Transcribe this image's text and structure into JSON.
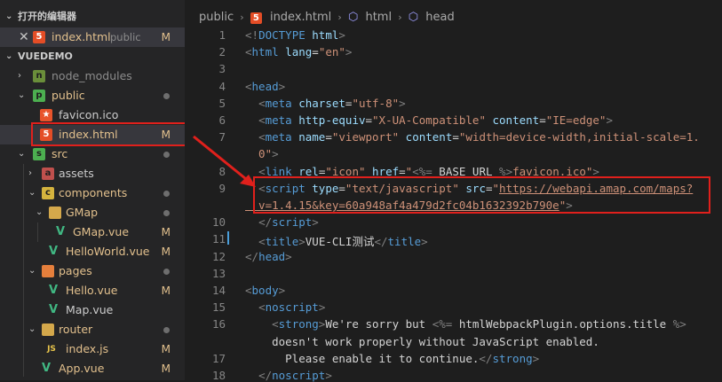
{
  "explorer": {
    "open_editors_title": "打开的编辑器",
    "open_editor_item": {
      "name": "index.html",
      "folder": "public",
      "status": "M"
    },
    "project_title": "VUEDEMO",
    "tree": [
      {
        "name": "node_modules",
        "type": "folder"
      },
      {
        "name": "public",
        "type": "folder"
      },
      {
        "name": "favicon.ico",
        "type": "file"
      },
      {
        "name": "index.html",
        "type": "file",
        "status": "M"
      },
      {
        "name": "src",
        "type": "folder"
      },
      {
        "name": "assets",
        "type": "folder"
      },
      {
        "name": "components",
        "type": "folder"
      },
      {
        "name": "GMap",
        "type": "folder"
      },
      {
        "name": "GMap.vue",
        "type": "file",
        "status": "M"
      },
      {
        "name": "HelloWorld.vue",
        "type": "file",
        "status": "M"
      },
      {
        "name": "pages",
        "type": "folder"
      },
      {
        "name": "Hello.vue",
        "type": "file",
        "status": "M"
      },
      {
        "name": "Map.vue",
        "type": "file"
      },
      {
        "name": "router",
        "type": "folder"
      },
      {
        "name": "index.js",
        "type": "file",
        "status": "M"
      },
      {
        "name": "App.vue",
        "type": "file",
        "status": "M"
      }
    ]
  },
  "breadcrumb": {
    "folder": "public",
    "file": "index.html",
    "node1": "html",
    "node2": "head"
  },
  "code": {
    "line_numbers": [
      "1",
      "2",
      "3",
      "4",
      "5",
      "6",
      "7",
      "8",
      "9",
      "10",
      "11",
      "12",
      "13",
      "14",
      "15",
      "16",
      "17",
      "18"
    ],
    "lines": [
      [
        [
          "t-punc",
          "<!"
        ],
        [
          "t-tag",
          "DOCTYPE"
        ],
        [
          "t-text",
          " "
        ],
        [
          "t-attr",
          "html"
        ],
        [
          "t-punc",
          ">"
        ]
      ],
      [
        [
          "t-punc",
          "<"
        ],
        [
          "t-tag",
          "html"
        ],
        [
          "t-text",
          " "
        ],
        [
          "t-attr",
          "lang"
        ],
        [
          "t-text",
          "="
        ],
        [
          "t-str",
          "\"en\""
        ],
        [
          "t-punc",
          ">"
        ]
      ],
      [],
      [
        [
          "t-punc",
          "<"
        ],
        [
          "t-tag",
          "head"
        ],
        [
          "t-punc",
          ">"
        ]
      ],
      [
        [
          "t-text",
          "  "
        ],
        [
          "t-punc",
          "<"
        ],
        [
          "t-tag",
          "meta"
        ],
        [
          "t-text",
          " "
        ],
        [
          "t-attr",
          "charset"
        ],
        [
          "t-text",
          "="
        ],
        [
          "t-str",
          "\"utf-8\""
        ],
        [
          "t-punc",
          ">"
        ]
      ],
      [
        [
          "t-text",
          "  "
        ],
        [
          "t-punc",
          "<"
        ],
        [
          "t-tag",
          "meta"
        ],
        [
          "t-text",
          " "
        ],
        [
          "t-attr",
          "http-equiv"
        ],
        [
          "t-text",
          "="
        ],
        [
          "t-str",
          "\"X-UA-Compatible\""
        ],
        [
          "t-text",
          " "
        ],
        [
          "t-attr",
          "content"
        ],
        [
          "t-text",
          "="
        ],
        [
          "t-str",
          "\"IE=edge\""
        ],
        [
          "t-punc",
          ">"
        ]
      ],
      [
        [
          "t-text",
          "  "
        ],
        [
          "t-punc",
          "<"
        ],
        [
          "t-tag",
          "meta"
        ],
        [
          "t-text",
          " "
        ],
        [
          "t-attr",
          "name"
        ],
        [
          "t-text",
          "="
        ],
        [
          "t-str",
          "\"viewport\""
        ],
        [
          "t-text",
          " "
        ],
        [
          "t-attr",
          "content"
        ],
        [
          "t-text",
          "="
        ],
        [
          "t-str",
          "\"width=device-width,initial-scale=1."
        ]
      ],
      [
        [
          "t-str",
          "  0\""
        ],
        [
          "t-punc",
          ">"
        ]
      ],
      [
        [
          "t-text",
          "  "
        ],
        [
          "t-punc",
          "<"
        ],
        [
          "t-tag",
          "link"
        ],
        [
          "t-text",
          " "
        ],
        [
          "t-attr",
          "rel"
        ],
        [
          "t-text",
          "="
        ],
        [
          "t-str",
          "\"icon\""
        ],
        [
          "t-text",
          " "
        ],
        [
          "t-attr",
          "href"
        ],
        [
          "t-text",
          "="
        ],
        [
          "t-str",
          "\""
        ],
        [
          "t-punc",
          "<%="
        ],
        [
          "t-text",
          " BASE_URL "
        ],
        [
          "t-punc",
          "%>"
        ],
        [
          "t-str",
          "favicon.ico\""
        ],
        [
          "t-punc",
          ">"
        ]
      ],
      [
        [
          "t-text",
          "  "
        ],
        [
          "t-punc",
          "<"
        ],
        [
          "t-tag",
          "script"
        ],
        [
          "t-text",
          " "
        ],
        [
          "t-attr",
          "type"
        ],
        [
          "t-text",
          "="
        ],
        [
          "t-str",
          "\"text/javascript\""
        ],
        [
          "t-text",
          " "
        ],
        [
          "t-attr",
          "src"
        ],
        [
          "t-text",
          "="
        ],
        [
          "t-str",
          "\""
        ],
        [
          "t-url",
          "https://webapi.amap.com/maps?"
        ]
      ],
      [
        [
          "t-url",
          "  v=1.4.15&key=60a948af4a479d2fc04b1632392b790e"
        ],
        [
          "t-str",
          "\""
        ],
        [
          "t-punc",
          ">"
        ]
      ],
      [
        [
          "t-text",
          "  "
        ],
        [
          "t-punc",
          "</"
        ],
        [
          "t-tag",
          "script"
        ],
        [
          "t-punc",
          ">"
        ]
      ],
      [
        [
          "t-text",
          "  "
        ],
        [
          "t-punc",
          "<"
        ],
        [
          "t-tag",
          "title"
        ],
        [
          "t-punc",
          ">"
        ],
        [
          "t-text",
          "VUE-CLI测试"
        ],
        [
          "t-punc",
          "</"
        ],
        [
          "t-tag",
          "title"
        ],
        [
          "t-punc",
          ">"
        ]
      ],
      [
        [
          "t-punc",
          "</"
        ],
        [
          "t-tag",
          "head"
        ],
        [
          "t-punc",
          ">"
        ]
      ],
      [],
      [
        [
          "t-punc",
          "<"
        ],
        [
          "t-tag",
          "body"
        ],
        [
          "t-punc",
          ">"
        ]
      ],
      [
        [
          "t-text",
          "  "
        ],
        [
          "t-punc",
          "<"
        ],
        [
          "t-tag",
          "noscript"
        ],
        [
          "t-punc",
          ">"
        ]
      ],
      [
        [
          "t-text",
          "    "
        ],
        [
          "t-punc",
          "<"
        ],
        [
          "t-tag",
          "strong"
        ],
        [
          "t-punc",
          ">"
        ],
        [
          "t-text",
          "We're sorry but "
        ],
        [
          "t-punc",
          "<%="
        ],
        [
          "t-text",
          " htmlWebpackPlugin.options.title "
        ],
        [
          "t-punc",
          "%>"
        ]
      ],
      [
        [
          "t-text",
          "    doesn't work properly without JavaScript enabled."
        ]
      ],
      [
        [
          "t-text",
          "      Please enable it to continue."
        ],
        [
          "t-punc",
          "</"
        ],
        [
          "t-tag",
          "strong"
        ],
        [
          "t-punc",
          ">"
        ]
      ],
      [
        [
          "t-text",
          "  "
        ],
        [
          "t-punc",
          "</"
        ],
        [
          "t-tag",
          "noscript"
        ],
        [
          "t-punc",
          ">"
        ]
      ]
    ]
  }
}
